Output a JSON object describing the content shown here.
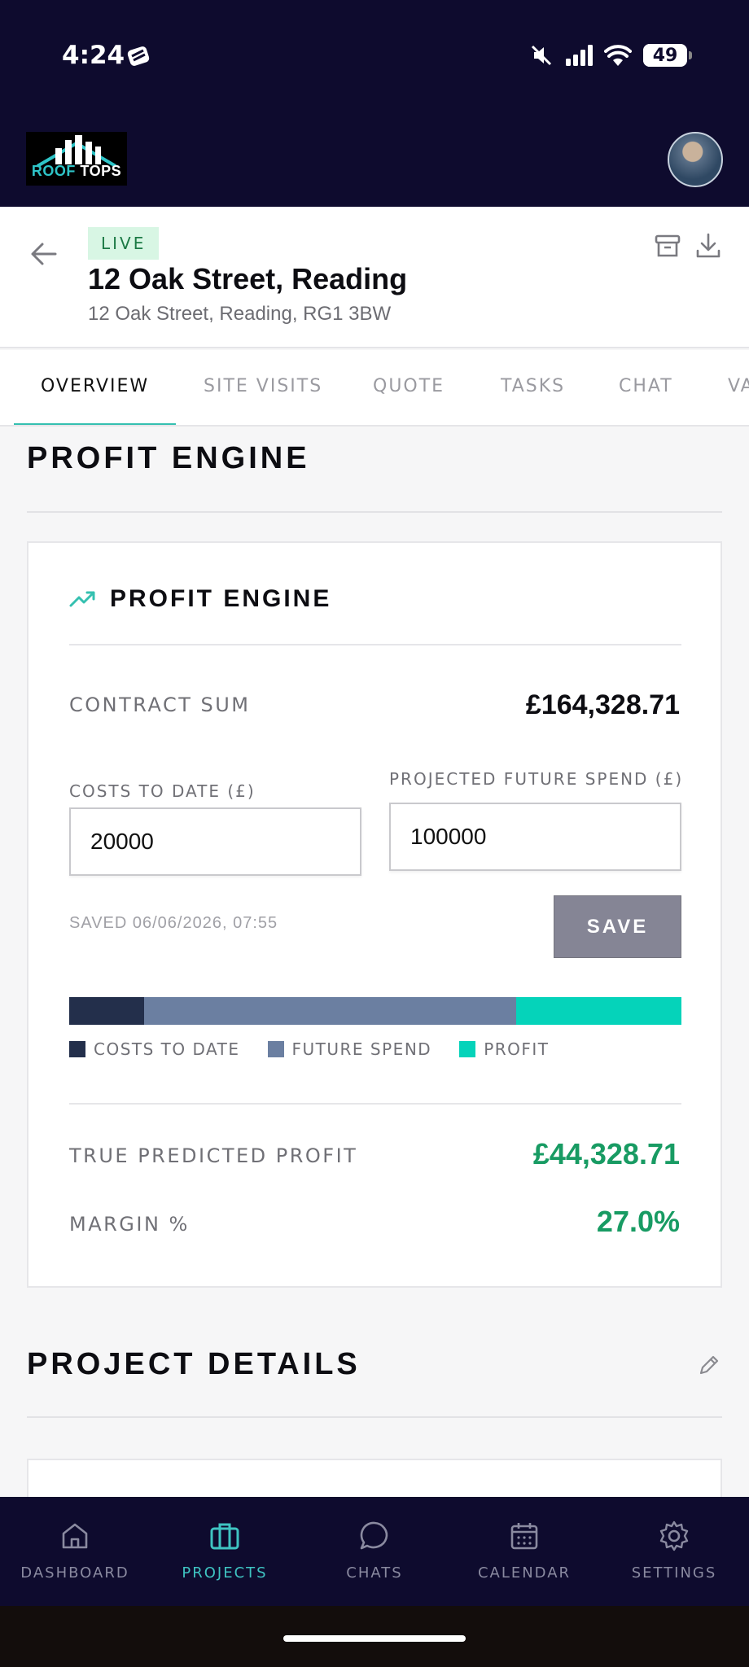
{
  "status_bar": {
    "time": "4:24",
    "battery": "49",
    "icons": [
      "app-icon",
      "mute-icon",
      "signal-icon",
      "wifi-icon",
      "battery-icon"
    ]
  },
  "header": {
    "logo_text_1": "ROOF",
    "logo_text_2": "TOPS",
    "avatar": "user-avatar"
  },
  "project": {
    "status_badge": "LIVE",
    "title": "12 Oak Street, Reading",
    "address": "12 Oak Street, Reading, RG1 3BW"
  },
  "tabs": [
    "OVERVIEW",
    "SITE VISITS",
    "QUOTE",
    "TASKS",
    "CHAT",
    "VA"
  ],
  "active_tab": "OVERVIEW",
  "sections": {
    "profit_engine_heading": "PROFIT ENGINE",
    "project_details_heading": "PROJECT DETAILS"
  },
  "profit_engine": {
    "card_title": "PROFIT ENGINE",
    "contract_sum_label": "CONTRACT SUM",
    "contract_sum_value": "£164,328.71",
    "costs_to_date_label": "COSTS TO DATE (£)",
    "costs_to_date_value": "20000",
    "future_spend_label": "PROJECTED FUTURE SPEND (£)",
    "future_spend_value": "100000",
    "saved_text": "SAVED 06/06/2026, 07:55",
    "save_label": "SAVE",
    "breakdown_bar": {
      "segments": [
        {
          "name": "COSTS TO DATE",
          "value": 20000,
          "color": "#232f4b"
        },
        {
          "name": "FUTURE SPEND",
          "value": 100000,
          "color": "#6b7fa1"
        },
        {
          "name": "PROFIT",
          "value": 44328.71,
          "color": "#05d3ba"
        }
      ]
    },
    "true_profit_label": "TRUE PREDICTED PROFIT",
    "true_profit_value": "£44,328.71",
    "margin_label": "MARGIN %",
    "margin_value": "27.0%",
    "accent_green": "#189b63"
  },
  "bottom_nav": [
    {
      "label": "DASHBOARD",
      "icon": "home-icon"
    },
    {
      "label": "PROJECTS",
      "icon": "briefcase-icon",
      "active": true
    },
    {
      "label": "CHATS",
      "icon": "chat-bubble-icon"
    },
    {
      "label": "CALENDAR",
      "icon": "calendar-icon"
    },
    {
      "label": "SETTINGS",
      "icon": "gear-icon"
    }
  ]
}
